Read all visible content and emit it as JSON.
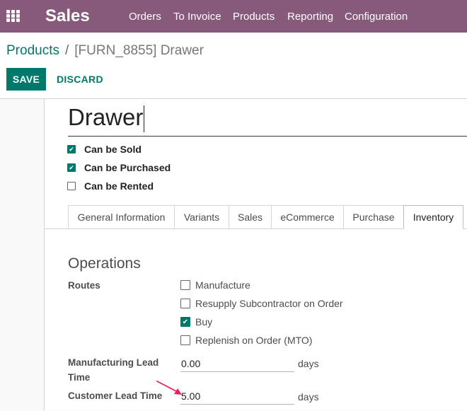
{
  "navbar": {
    "app_title": "Sales",
    "menu": [
      "Orders",
      "To Invoice",
      "Products",
      "Reporting",
      "Configuration"
    ]
  },
  "breadcrumb": {
    "parent": "Products",
    "separator": "/",
    "current": "[FURN_8855] Drawer"
  },
  "actions": {
    "save": "SAVE",
    "discard": "DISCARD"
  },
  "product": {
    "name": "Drawer",
    "flags": [
      {
        "label": "Can be Sold",
        "checked": true
      },
      {
        "label": "Can be Purchased",
        "checked": true
      },
      {
        "label": "Can be Rented",
        "checked": false
      }
    ]
  },
  "tabs": [
    {
      "label": "General Information",
      "active": false
    },
    {
      "label": "Variants",
      "active": false
    },
    {
      "label": "Sales",
      "active": false
    },
    {
      "label": "eCommerce",
      "active": false
    },
    {
      "label": "Purchase",
      "active": false
    },
    {
      "label": "Inventory",
      "active": true
    }
  ],
  "operations": {
    "title": "Operations",
    "routes_label": "Routes",
    "routes": [
      {
        "label": "Manufacture",
        "checked": false
      },
      {
        "label": "Resupply Subcontractor on Order",
        "checked": false
      },
      {
        "label": "Buy",
        "checked": true
      },
      {
        "label": "Replenish on Order (MTO)",
        "checked": false
      }
    ],
    "manufacturing_lead_time": {
      "label": "Manufacturing Lead Time",
      "value": "0.00",
      "unit": "days"
    },
    "customer_lead_time": {
      "label": "Customer Lead Time",
      "value": "5.00",
      "unit": "days"
    }
  },
  "colors": {
    "navbar": "#875a7b",
    "primary": "#00796b",
    "annotation_arrow": "#e91e63"
  }
}
